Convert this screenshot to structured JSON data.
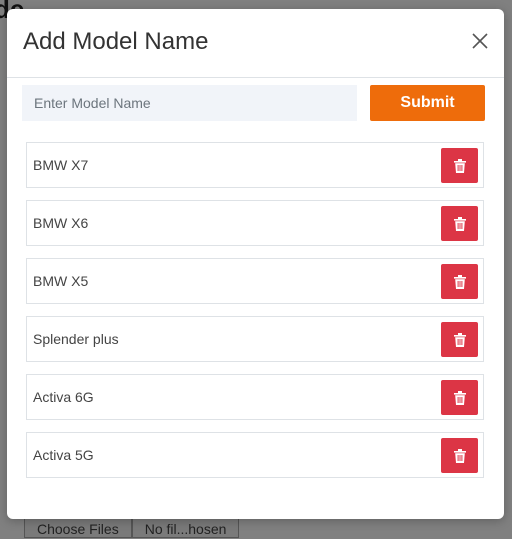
{
  "background": {
    "heading_fragment": "de",
    "file_button": "Choose Files",
    "file_status": "No fil...hosen"
  },
  "modal": {
    "title": "Add Model Name",
    "close_icon": "close-icon",
    "input": {
      "value": "",
      "placeholder": "Enter Model Name"
    },
    "submit_label": "Submit",
    "items": [
      {
        "name": "BMW X7"
      },
      {
        "name": "BMW X6"
      },
      {
        "name": "BMW X5"
      },
      {
        "name": "Splender plus"
      },
      {
        "name": "Activa 6G"
      },
      {
        "name": "Activa 5G"
      }
    ],
    "delete_icon": "trash-icon"
  },
  "colors": {
    "overlay": "#808080",
    "submit": "#ee6c0b",
    "delete": "#dc3545",
    "input_bg": "#f1f4f9"
  }
}
